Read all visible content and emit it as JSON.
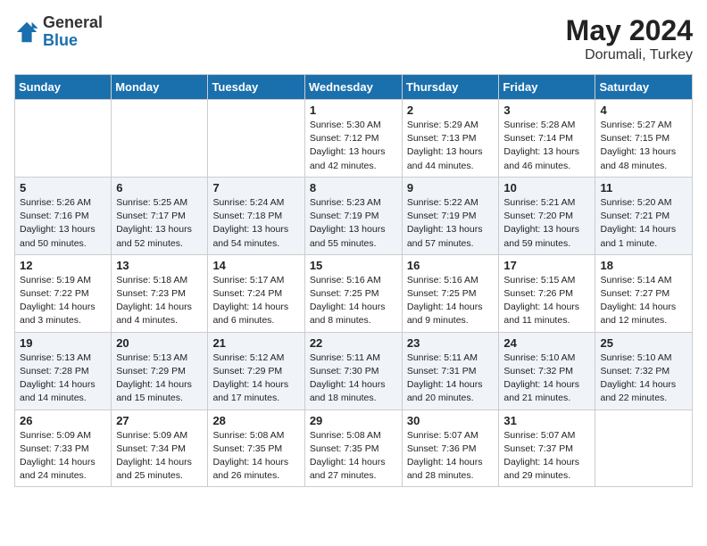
{
  "header": {
    "logo_general": "General",
    "logo_blue": "Blue",
    "month_year": "May 2024",
    "location": "Dorumali, Turkey"
  },
  "weekdays": [
    "Sunday",
    "Monday",
    "Tuesday",
    "Wednesday",
    "Thursday",
    "Friday",
    "Saturday"
  ],
  "weeks": [
    [
      null,
      null,
      null,
      {
        "day": 1,
        "sunrise": "5:30 AM",
        "sunset": "7:12 PM",
        "daylight": "13 hours and 42 minutes."
      },
      {
        "day": 2,
        "sunrise": "5:29 AM",
        "sunset": "7:13 PM",
        "daylight": "13 hours and 44 minutes."
      },
      {
        "day": 3,
        "sunrise": "5:28 AM",
        "sunset": "7:14 PM",
        "daylight": "13 hours and 46 minutes."
      },
      {
        "day": 4,
        "sunrise": "5:27 AM",
        "sunset": "7:15 PM",
        "daylight": "13 hours and 48 minutes."
      }
    ],
    [
      {
        "day": 5,
        "sunrise": "5:26 AM",
        "sunset": "7:16 PM",
        "daylight": "13 hours and 50 minutes."
      },
      {
        "day": 6,
        "sunrise": "5:25 AM",
        "sunset": "7:17 PM",
        "daylight": "13 hours and 52 minutes."
      },
      {
        "day": 7,
        "sunrise": "5:24 AM",
        "sunset": "7:18 PM",
        "daylight": "13 hours and 54 minutes."
      },
      {
        "day": 8,
        "sunrise": "5:23 AM",
        "sunset": "7:19 PM",
        "daylight": "13 hours and 55 minutes."
      },
      {
        "day": 9,
        "sunrise": "5:22 AM",
        "sunset": "7:19 PM",
        "daylight": "13 hours and 57 minutes."
      },
      {
        "day": 10,
        "sunrise": "5:21 AM",
        "sunset": "7:20 PM",
        "daylight": "13 hours and 59 minutes."
      },
      {
        "day": 11,
        "sunrise": "5:20 AM",
        "sunset": "7:21 PM",
        "daylight": "14 hours and 1 minute."
      }
    ],
    [
      {
        "day": 12,
        "sunrise": "5:19 AM",
        "sunset": "7:22 PM",
        "daylight": "14 hours and 3 minutes."
      },
      {
        "day": 13,
        "sunrise": "5:18 AM",
        "sunset": "7:23 PM",
        "daylight": "14 hours and 4 minutes."
      },
      {
        "day": 14,
        "sunrise": "5:17 AM",
        "sunset": "7:24 PM",
        "daylight": "14 hours and 6 minutes."
      },
      {
        "day": 15,
        "sunrise": "5:16 AM",
        "sunset": "7:25 PM",
        "daylight": "14 hours and 8 minutes."
      },
      {
        "day": 16,
        "sunrise": "5:16 AM",
        "sunset": "7:25 PM",
        "daylight": "14 hours and 9 minutes."
      },
      {
        "day": 17,
        "sunrise": "5:15 AM",
        "sunset": "7:26 PM",
        "daylight": "14 hours and 11 minutes."
      },
      {
        "day": 18,
        "sunrise": "5:14 AM",
        "sunset": "7:27 PM",
        "daylight": "14 hours and 12 minutes."
      }
    ],
    [
      {
        "day": 19,
        "sunrise": "5:13 AM",
        "sunset": "7:28 PM",
        "daylight": "14 hours and 14 minutes."
      },
      {
        "day": 20,
        "sunrise": "5:13 AM",
        "sunset": "7:29 PM",
        "daylight": "14 hours and 15 minutes."
      },
      {
        "day": 21,
        "sunrise": "5:12 AM",
        "sunset": "7:29 PM",
        "daylight": "14 hours and 17 minutes."
      },
      {
        "day": 22,
        "sunrise": "5:11 AM",
        "sunset": "7:30 PM",
        "daylight": "14 hours and 18 minutes."
      },
      {
        "day": 23,
        "sunrise": "5:11 AM",
        "sunset": "7:31 PM",
        "daylight": "14 hours and 20 minutes."
      },
      {
        "day": 24,
        "sunrise": "5:10 AM",
        "sunset": "7:32 PM",
        "daylight": "14 hours and 21 minutes."
      },
      {
        "day": 25,
        "sunrise": "5:10 AM",
        "sunset": "7:32 PM",
        "daylight": "14 hours and 22 minutes."
      }
    ],
    [
      {
        "day": 26,
        "sunrise": "5:09 AM",
        "sunset": "7:33 PM",
        "daylight": "14 hours and 24 minutes."
      },
      {
        "day": 27,
        "sunrise": "5:09 AM",
        "sunset": "7:34 PM",
        "daylight": "14 hours and 25 minutes."
      },
      {
        "day": 28,
        "sunrise": "5:08 AM",
        "sunset": "7:35 PM",
        "daylight": "14 hours and 26 minutes."
      },
      {
        "day": 29,
        "sunrise": "5:08 AM",
        "sunset": "7:35 PM",
        "daylight": "14 hours and 27 minutes."
      },
      {
        "day": 30,
        "sunrise": "5:07 AM",
        "sunset": "7:36 PM",
        "daylight": "14 hours and 28 minutes."
      },
      {
        "day": 31,
        "sunrise": "5:07 AM",
        "sunset": "7:37 PM",
        "daylight": "14 hours and 29 minutes."
      },
      null
    ]
  ],
  "labels": {
    "sunrise": "Sunrise:",
    "sunset": "Sunset:",
    "daylight": "Daylight:"
  }
}
